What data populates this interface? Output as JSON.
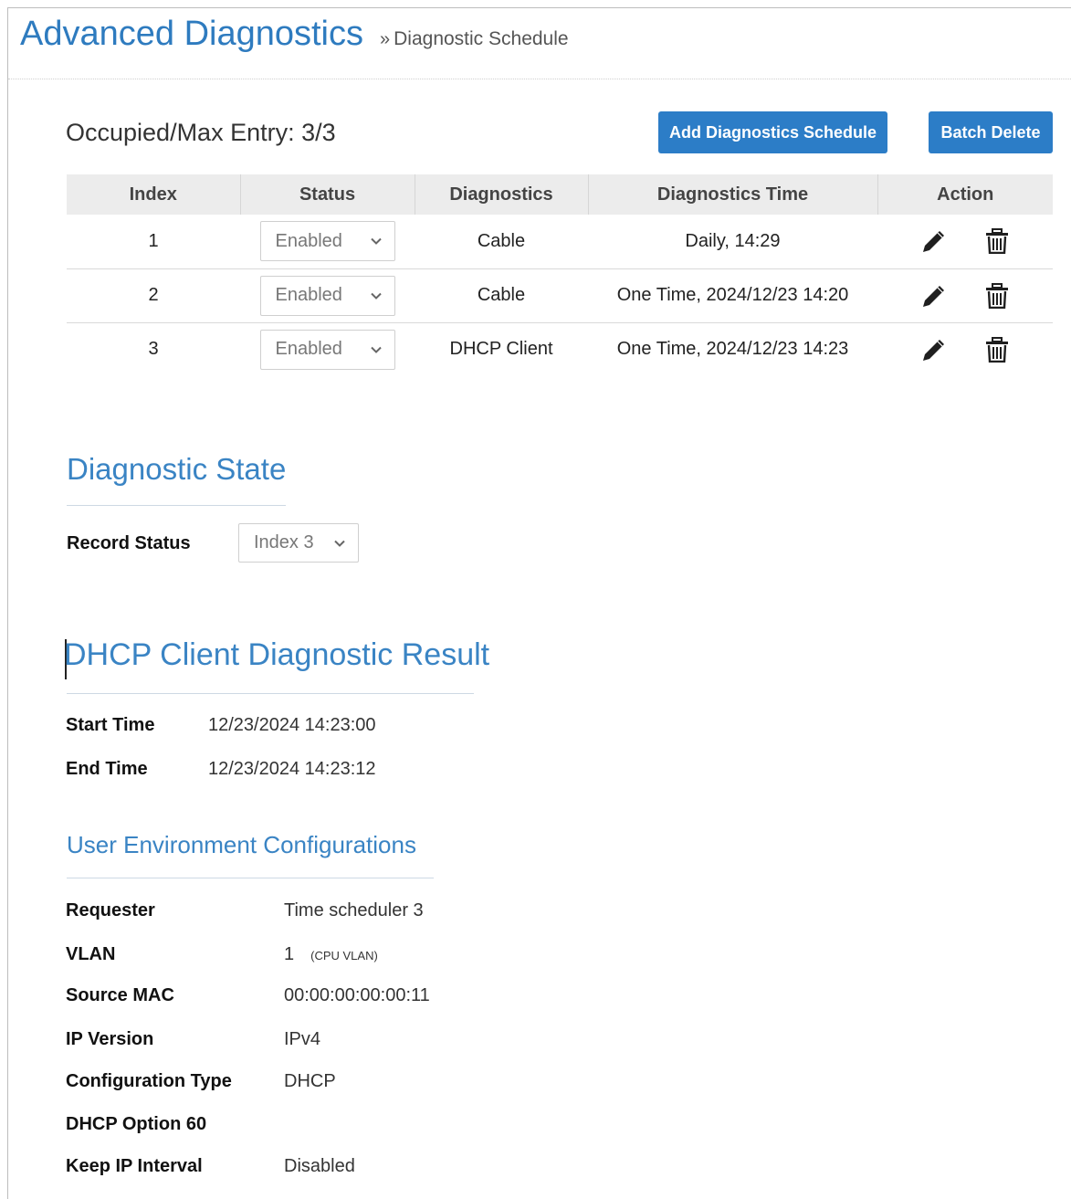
{
  "header": {
    "title": "Advanced Diagnostics",
    "breadcrumb_sep": "»",
    "breadcrumb": "Diagnostic Schedule"
  },
  "schedule": {
    "entry_count": "Occupied/Max Entry: 3/3",
    "add_button": "Add Diagnostics Schedule",
    "batch_delete_button": "Batch Delete",
    "columns": [
      "Index",
      "Status",
      "Diagnostics",
      "Diagnostics Time",
      "Action"
    ],
    "rows": [
      {
        "index": "1",
        "status": "Enabled",
        "diagnostics": "Cable",
        "time": "Daily, 14:29"
      },
      {
        "index": "2",
        "status": "Enabled",
        "diagnostics": "Cable",
        "time": "One Time, 2024/12/23 14:20"
      },
      {
        "index": "3",
        "status": "Enabled",
        "diagnostics": "DHCP Client",
        "time": "One Time, 2024/12/23 14:23"
      }
    ],
    "row_icons": [
      "edit-pencil-icon",
      "trash-icon"
    ]
  },
  "state": {
    "title": "Diagnostic State",
    "record_status_label": "Record Status",
    "record_status_value": "Index 3"
  },
  "result": {
    "title": "DHCP Client Diagnostic Result",
    "start_label": "Start Time",
    "start_value": "12/23/2024 14:23:00",
    "end_label": "End Time",
    "end_value": "12/23/2024 14:23:12"
  },
  "env": {
    "title": "User Environment Configurations",
    "requester_label": "Requester",
    "requester_value": "Time scheduler 3",
    "vlan_label": "VLAN",
    "vlan_value": "1",
    "vlan_note": "(CPU VLAN)",
    "mac_label": "Source MAC",
    "mac_value": "00:00:00:00:00:11",
    "ipver_label": "IP Version",
    "ipver_value": "IPv4",
    "cfgtype_label": "Configuration Type",
    "cfgtype_value": "DHCP",
    "opt60_label": "DHCP Option 60",
    "opt60_value": "",
    "keepip_label": "Keep IP Interval",
    "keepip_value": "Disabled"
  },
  "colors": {
    "accent": "#2e7bbf",
    "button": "#2c7dc7",
    "table_header_bg": "#ececec"
  }
}
